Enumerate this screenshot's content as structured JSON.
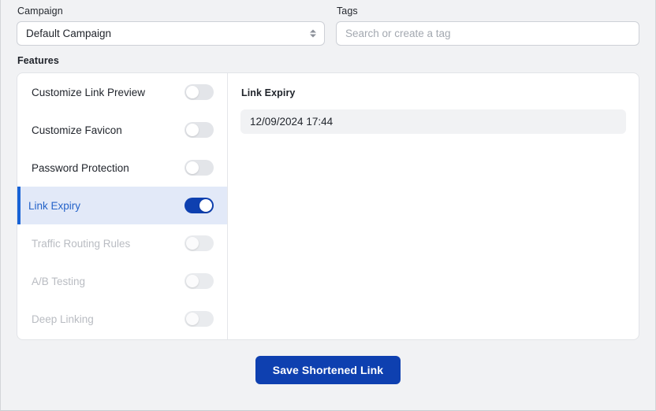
{
  "campaign": {
    "label": "Campaign",
    "selected": "Default Campaign",
    "options": [
      "Default Campaign"
    ],
    "icon": "chevron-up-down-icon"
  },
  "tags": {
    "label": "Tags",
    "value": "",
    "placeholder": "Search or create a tag"
  },
  "features": {
    "label": "Features",
    "items": [
      {
        "label": "Customize Link Preview",
        "enabled": false,
        "selected": false,
        "disabled": false
      },
      {
        "label": "Customize Favicon",
        "enabled": false,
        "selected": false,
        "disabled": false
      },
      {
        "label": "Password Protection",
        "enabled": false,
        "selected": false,
        "disabled": false
      },
      {
        "label": "Link Expiry",
        "enabled": true,
        "selected": true,
        "disabled": false
      },
      {
        "label": "Traffic Routing Rules",
        "enabled": false,
        "selected": false,
        "disabled": true
      },
      {
        "label": "A/B Testing",
        "enabled": false,
        "selected": false,
        "disabled": true
      },
      {
        "label": "Deep Linking",
        "enabled": false,
        "selected": false,
        "disabled": true
      }
    ]
  },
  "detail": {
    "title": "Link Expiry",
    "expiry_value": "12/09/2024 17:44"
  },
  "footer": {
    "save_label": "Save Shortened Link"
  },
  "colors": {
    "accent_blue": "#0e40b0",
    "selected_row_bg": "#e2e9f8",
    "selected_row_border": "#1863d6",
    "selected_text": "#2563c9",
    "page_bg": "#f1f2f4",
    "card_bg": "#ffffff",
    "field_bg": "#f1f2f4",
    "toggle_off": "#e3e5e9",
    "disabled_text": "#b9bcc2"
  }
}
